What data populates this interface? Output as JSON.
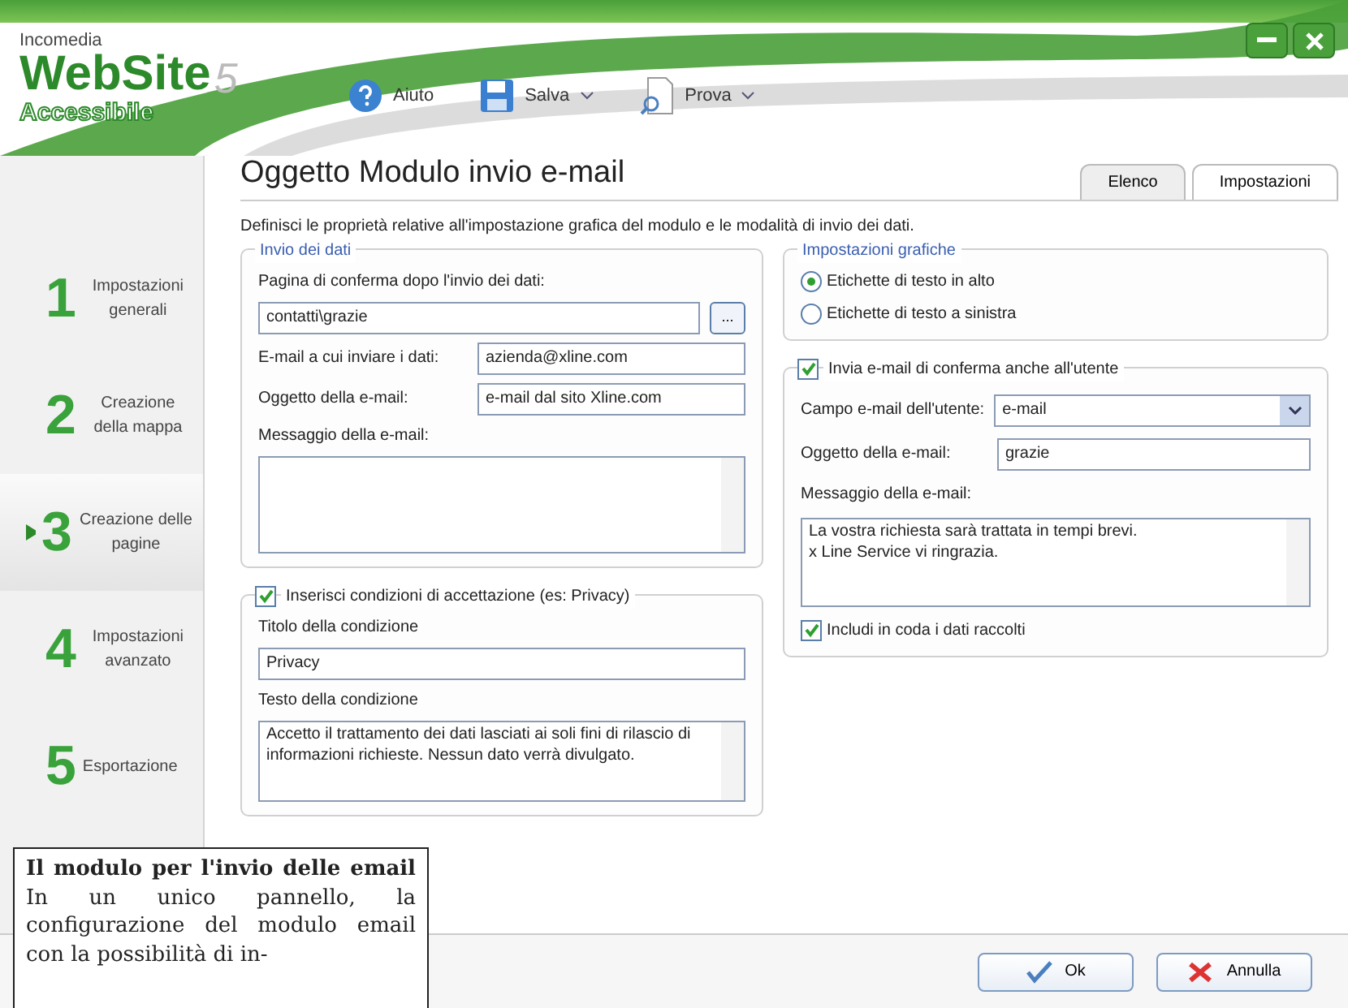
{
  "logo": {
    "company": "Incomedia",
    "product": "WebSite",
    "version": "5",
    "edition": "Accessibile"
  },
  "toolbar": [
    {
      "label": "Aiuto",
      "kind": "help",
      "dropdown": false
    },
    {
      "label": "Salva",
      "kind": "save",
      "dropdown": true
    },
    {
      "label": "Prova",
      "kind": "preview",
      "dropdown": true
    }
  ],
  "steps": [
    {
      "number": "1",
      "label": "Impostazioni generali",
      "selected": false
    },
    {
      "number": "2",
      "label": "Creazione della mappa",
      "selected": false
    },
    {
      "number": "3",
      "label": "Creazione delle pagine",
      "selected": true
    },
    {
      "number": "4",
      "label": "Impostazioni avanzato",
      "selected": false
    },
    {
      "number": "5",
      "label": "Esportazione",
      "selected": false
    }
  ],
  "title": "Oggetto Modulo invio e-mail",
  "tabs": [
    {
      "label": "Elenco",
      "selected": false
    },
    {
      "label": "Impostazioni",
      "selected": true
    }
  ],
  "description": "Definisci le proprietà relative all'impostazione grafica del modulo e le modalità di invio dei dati.",
  "send_group": {
    "title": "Invio dei dati",
    "confirm_page": {
      "label": "Pagina di conferma dopo l'invio dei dati:",
      "value": "contatti\\grazie",
      "browse": "..."
    },
    "email_to": {
      "label": "E-mail a cui inviare i dati:",
      "value": "azienda@xline.com"
    },
    "subject": {
      "label": "Oggetto della e-mail:",
      "value": "e-mail dal sito Xline.com"
    },
    "message": {
      "label": "Messaggio della e-mail:"
    }
  },
  "privacy_group": {
    "label": "Inserisci condizioni di accettazione (es: Privacy)",
    "checked": true,
    "condition_title": {
      "label": "Titolo della condizione",
      "value": "Privacy"
    },
    "condition_text": {
      "label": "Testo della condizione",
      "value": "Accetto il trattamento dei dati lasciati ai soli fini di rilascio di informazioni richieste. Nessun dato verrà divulgato."
    }
  },
  "graphics_group": {
    "title": "Impostazioni grafiche",
    "options": [
      {
        "label": "Etichette di testo in alto",
        "selected": true
      },
      {
        "label": "Etichette di testo a sinistra",
        "selected": false
      }
    ]
  },
  "user_group": {
    "label": "Invia e-mail di conferma anche all'utente",
    "checked": true,
    "email_field": {
      "label": "Campo e-mail dell'utente:",
      "value": "e-mail"
    },
    "subject": {
      "label": "Oggetto della e-mail:",
      "value": "grazie"
    },
    "message": {
      "label": "Messaggio della e-mail:",
      "value": "La vostra richiesta sarà trattata in tempi brevi.\nx Line Service vi ringrazia."
    },
    "include": {
      "label": "Includi in coda i dati raccolti",
      "checked": true
    }
  },
  "buttons": [
    {
      "label": "Ok",
      "kind": "ok"
    },
    {
      "label": "Annulla",
      "kind": "cancel"
    }
  ],
  "caption": "**Il modulo per l'invio delle email** In un unico pannello, la configurazione del modulo email con la possibilità di in-"
}
